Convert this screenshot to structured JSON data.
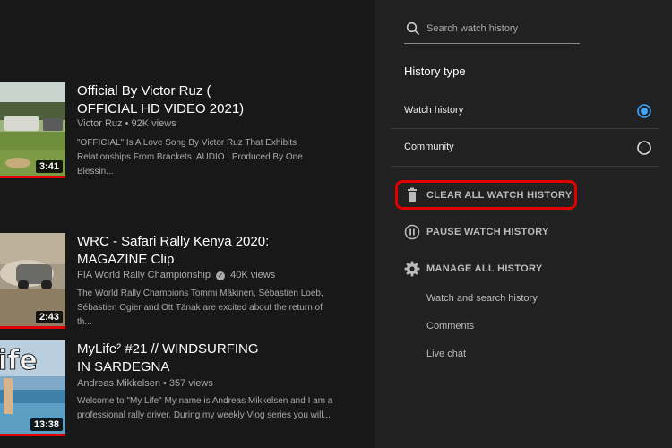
{
  "videos": [
    {
      "title": "Official By Victor Ruz ( OFFICIAL HD VIDEO 2021)",
      "channel": "Victor Ruz",
      "views": "92K views",
      "description": "\"OFFICIAL\" Is A Love Song By Victor Ruz That Exhibits Relationships From Brackets. AUDIO : Produced By One Blessin...",
      "duration": "3:41",
      "progress": 1.0,
      "verified": false
    },
    {
      "title": "WRC - Safari Rally Kenya 2020: MAGAZINE Clip",
      "channel": "FIA World Rally Championship",
      "views": "40K views",
      "description": "The World Rally Champions Tommi Mäkinen, Sébastien Loeb, Sébastien Ogier and Ott Tänak are excited about the return of th...",
      "duration": "2:43",
      "progress": 1.0,
      "verified": true
    },
    {
      "title": "MyLife² #21 // WINDSURFING IN SARDEGNA",
      "channel": "Andreas Mikkelsen",
      "views": "357 views",
      "description": "Welcome to \"My Life\" My name is Andreas Mikkelsen and I am a professional rally driver. During my weekly Vlog series you will...",
      "duration": "13:38",
      "progress": 1.0,
      "verified": false
    }
  ],
  "sidebar": {
    "search_placeholder": "Search watch history",
    "history_type_title": "History type",
    "options": [
      {
        "label": "Watch history",
        "selected": true
      },
      {
        "label": "Community",
        "selected": false
      }
    ],
    "actions": {
      "clear": "CLEAR ALL WATCH HISTORY",
      "pause": "PAUSE WATCH HISTORY",
      "manage": "MANAGE ALL HISTORY"
    },
    "manage_links": [
      "Watch and search history",
      "Comments",
      "Live chat"
    ]
  },
  "colors": {
    "accent": "#3ea6ff",
    "highlight": "#e00000",
    "progress": "#e00000"
  }
}
